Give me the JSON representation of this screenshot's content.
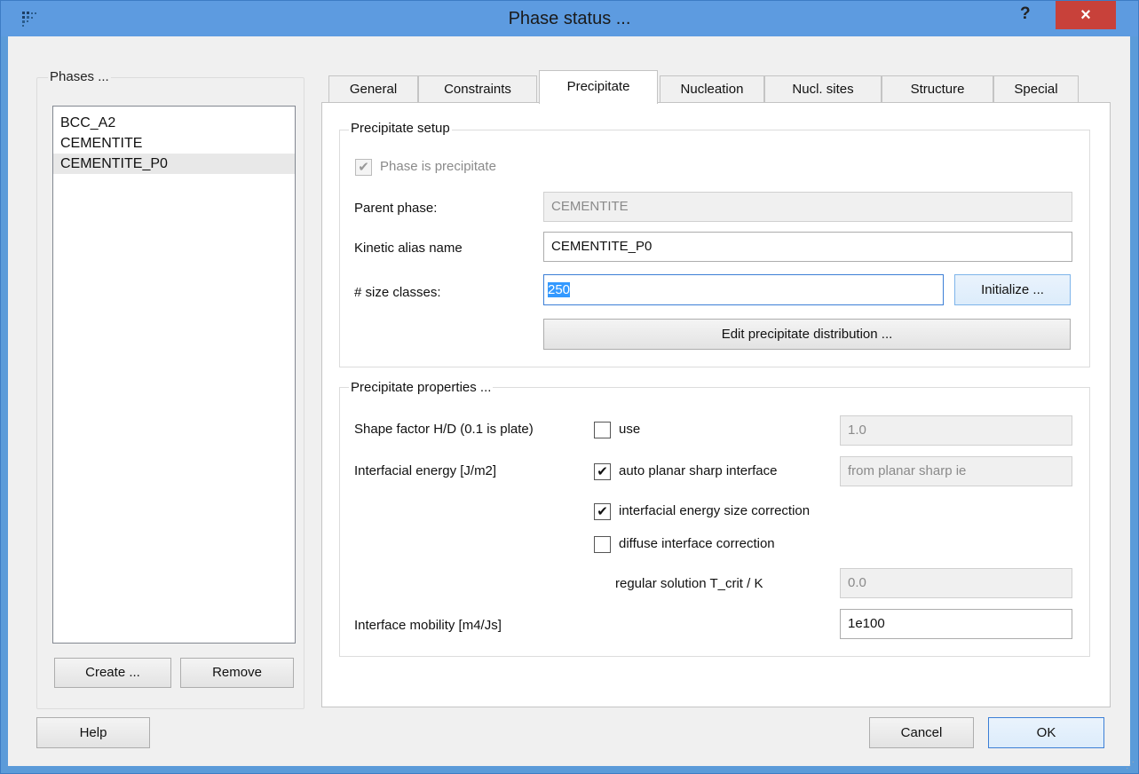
{
  "window": {
    "title": "Phase status ...",
    "help_glyph": "?",
    "close_glyph": "×",
    "icon": "app-logo-icon"
  },
  "phases": {
    "caption": "Phases ...",
    "items": [
      "BCC_A2",
      "CEMENTITE",
      "CEMENTITE_P0"
    ],
    "selected": "CEMENTITE_P0",
    "create_label": "Create ...",
    "remove_label": "Remove"
  },
  "tabs": [
    "General",
    "Constraints",
    "Precipitate",
    "Nucleation",
    "Nucl. sites",
    "Structure",
    "Special"
  ],
  "active_tab": "Precipitate",
  "setup": {
    "caption": "Precipitate setup",
    "is_precipitate_label": "Phase is precipitate",
    "is_precipitate_checked": true,
    "parent_label": "Parent phase:",
    "parent_value": "CEMENTITE",
    "alias_label": "Kinetic alias name",
    "alias_value": "CEMENTITE_P0",
    "size_label": "# size classes:",
    "size_value": "250",
    "initialize_label": "Initialize ...",
    "edit_dist_label": "Edit precipitate distribution ..."
  },
  "props": {
    "caption": "Precipitate properties ...",
    "shape_label": "Shape factor H/D (0.1 is plate)",
    "shape_use_label": "use",
    "shape_use_checked": false,
    "shape_value": "1.0",
    "ie_label": "Interfacial energy [J/m2]",
    "auto_label": "auto planar sharp interface",
    "auto_checked": true,
    "auto_value": "from planar sharp ie",
    "size_corr_label": "interfacial energy size correction",
    "size_corr_checked": true,
    "diffuse_label": "diffuse interface correction",
    "diffuse_checked": false,
    "tcrit_label": "regular solution T_crit / K",
    "tcrit_value": "0.0",
    "mobility_label": "Interface mobility [m4/Js]",
    "mobility_value": "1e100"
  },
  "footer": {
    "help_label": "Help",
    "cancel_label": "Cancel",
    "ok_label": "OK"
  }
}
